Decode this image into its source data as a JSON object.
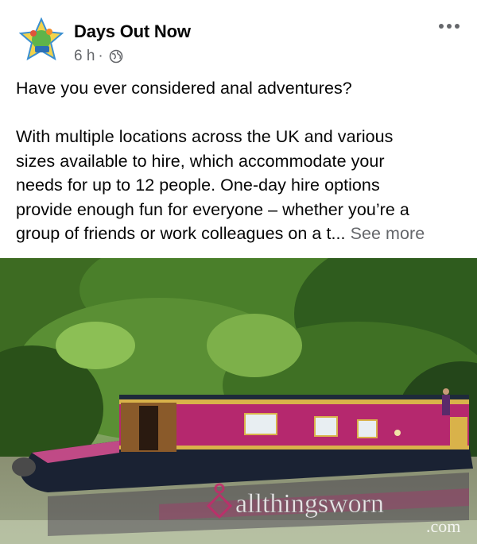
{
  "post": {
    "author": "Days Out Now",
    "time": "6 h",
    "separator": "·",
    "privacy_icon": "globe-icon",
    "more_icon": "more-options-icon",
    "lines_para1": [
      "Have you ever considered anal adventures?"
    ],
    "lines_para2": [
      "With multiple locations across the UK and various",
      "sizes available to hire, which accommodate your",
      "needs for up to 12 people. One-day hire options",
      "provide enough fun for everyone – whether you’re a"
    ],
    "last_line": "group of friends or work colleagues on a t...",
    "see_more": "See more"
  },
  "photo": {
    "subject": "narrowboat-photo",
    "watermark_brand": "allthingsworn",
    "watermark_suffix": ".com"
  },
  "colors": {
    "boat_hull": "#b5286e",
    "foliage": "#2f5c1e",
    "water": "#7a8a6a"
  }
}
